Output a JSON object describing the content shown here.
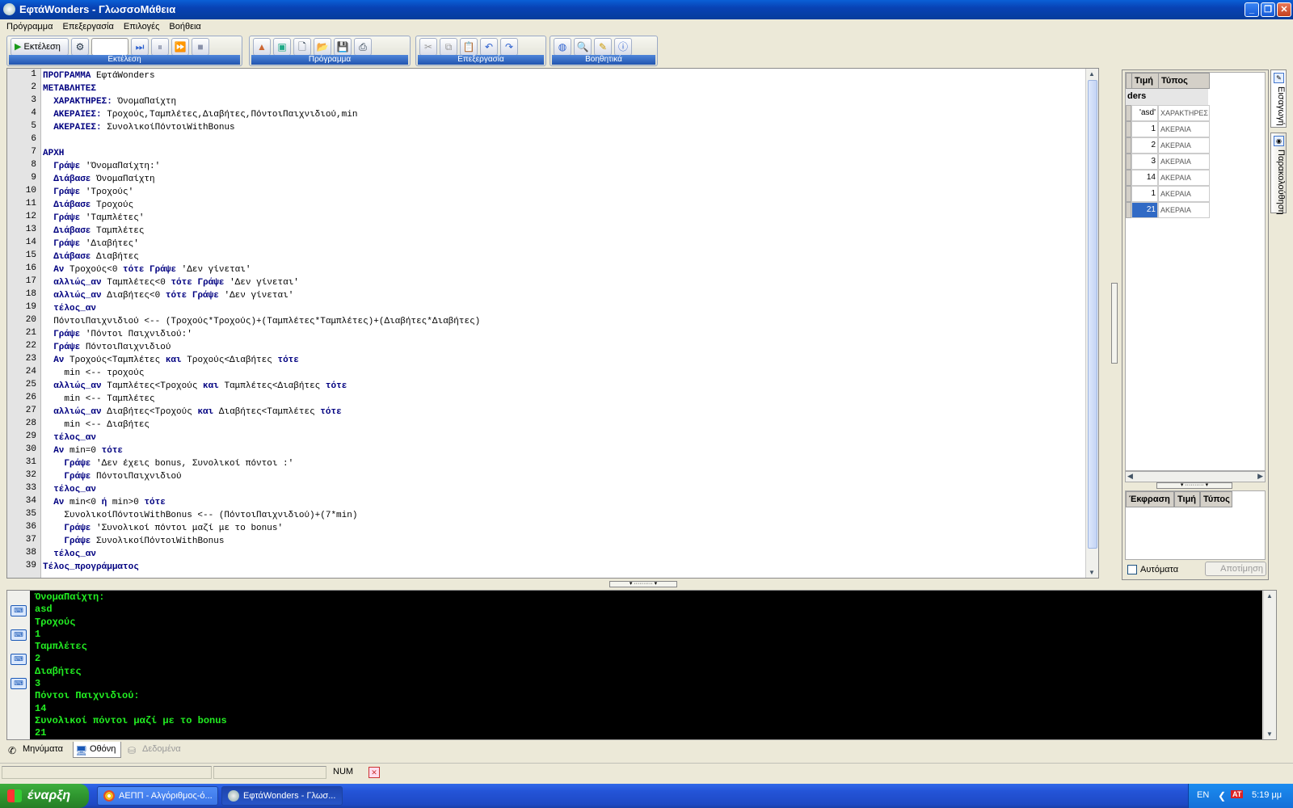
{
  "window": {
    "title": "ΕφτάWonders - ΓλωσσοΜάθεια"
  },
  "menu": [
    "Πρόγραμμα",
    "Επεξεργασία",
    "Επιλογές",
    "Βοήθεια"
  ],
  "toolbars": {
    "run_label": "Εκτέλεση",
    "groups": [
      "Εκτέλεση",
      "Πρόγραμμα",
      "Επεξεργασία",
      "Βοηθητικά"
    ]
  },
  "editor": {
    "lines": [
      {
        "n": "1",
        "parts": [
          {
            "t": "ΠΡΟΓΡΑΜΜΑ",
            "k": true
          },
          {
            "t": " ΕφτάWonders"
          }
        ]
      },
      {
        "n": "2",
        "parts": [
          {
            "t": "ΜΕΤΑΒΛΗΤΕΣ",
            "k": true
          }
        ]
      },
      {
        "n": "3",
        "parts": [
          {
            "t": "  "
          },
          {
            "t": "ΧΑΡΑΚΤΗΡΕΣ:",
            "k": true
          },
          {
            "t": " ΌνομαΠαίχτη"
          }
        ]
      },
      {
        "n": "4",
        "parts": [
          {
            "t": "  "
          },
          {
            "t": "ΑΚΕΡΑΙΕΣ:",
            "k": true
          },
          {
            "t": " Τροχούς,Ταμπλέτες,Διαβήτες,ΠόντοιΠαιχνιδιού,min"
          }
        ]
      },
      {
        "n": "5",
        "parts": [
          {
            "t": "  "
          },
          {
            "t": "ΑΚΕΡΑΙΕΣ:",
            "k": true
          },
          {
            "t": " ΣυνολικοίΠόντοιWithBonus"
          }
        ]
      },
      {
        "n": "6",
        "parts": [
          {
            "t": ""
          }
        ]
      },
      {
        "n": "7",
        "parts": [
          {
            "t": "ΑΡΧΗ",
            "k": true
          }
        ]
      },
      {
        "n": "8",
        "parts": [
          {
            "t": "  "
          },
          {
            "t": "Γράψε",
            "k": true
          },
          {
            "t": " 'ΌνομαΠαίχτη:'"
          }
        ]
      },
      {
        "n": "9",
        "parts": [
          {
            "t": "  "
          },
          {
            "t": "Διάβασε",
            "k": true
          },
          {
            "t": " ΌνομαΠαίχτη"
          }
        ]
      },
      {
        "n": "10",
        "parts": [
          {
            "t": "  "
          },
          {
            "t": "Γράψε",
            "k": true
          },
          {
            "t": " 'Τροχούς'"
          }
        ]
      },
      {
        "n": "11",
        "parts": [
          {
            "t": "  "
          },
          {
            "t": "Διάβασε",
            "k": true
          },
          {
            "t": " Τροχούς"
          }
        ]
      },
      {
        "n": "12",
        "parts": [
          {
            "t": "  "
          },
          {
            "t": "Γράψε",
            "k": true
          },
          {
            "t": " 'Ταμπλέτες'"
          }
        ]
      },
      {
        "n": "13",
        "parts": [
          {
            "t": "  "
          },
          {
            "t": "Διάβασε",
            "k": true
          },
          {
            "t": " Ταμπλέτες"
          }
        ]
      },
      {
        "n": "14",
        "parts": [
          {
            "t": "  "
          },
          {
            "t": "Γράψε",
            "k": true
          },
          {
            "t": " 'Διαβήτες'"
          }
        ]
      },
      {
        "n": "15",
        "parts": [
          {
            "t": "  "
          },
          {
            "t": "Διάβασε",
            "k": true
          },
          {
            "t": " Διαβήτες"
          }
        ]
      },
      {
        "n": "16",
        "parts": [
          {
            "t": "  "
          },
          {
            "t": "Αν",
            "k": true
          },
          {
            "t": " Τροχούς<0 "
          },
          {
            "t": "τότε",
            "k": true
          },
          {
            "t": " "
          },
          {
            "t": "Γράψε",
            "k": true
          },
          {
            "t": " 'Δεν γίνεται'"
          }
        ]
      },
      {
        "n": "17",
        "parts": [
          {
            "t": "  "
          },
          {
            "t": "αλλιώς_αν",
            "k": true
          },
          {
            "t": " Ταμπλέτες<0 "
          },
          {
            "t": "τότε",
            "k": true
          },
          {
            "t": " "
          },
          {
            "t": "Γράψε",
            "k": true
          },
          {
            "t": " 'Δεν γίνεται'"
          }
        ]
      },
      {
        "n": "18",
        "parts": [
          {
            "t": "  "
          },
          {
            "t": "αλλιώς_αν",
            "k": true
          },
          {
            "t": " Διαβήτες<0 "
          },
          {
            "t": "τότε",
            "k": true
          },
          {
            "t": " "
          },
          {
            "t": "Γράψε",
            "k": true
          },
          {
            "t": " 'Δεν γίνεται'"
          }
        ]
      },
      {
        "n": "19",
        "parts": [
          {
            "t": "  "
          },
          {
            "t": "τέλος_αν",
            "k": true
          }
        ]
      },
      {
        "n": "20",
        "parts": [
          {
            "t": "  ΠόντοιΠαιχνιδιού <-- (Τροχούς*Τροχούς)+(Ταμπλέτες*Ταμπλέτες)+(Διαβήτες*Διαβήτες)"
          }
        ]
      },
      {
        "n": "21",
        "parts": [
          {
            "t": "  "
          },
          {
            "t": "Γράψε",
            "k": true
          },
          {
            "t": " 'Πόντοι Παιχνιδιού:'"
          }
        ]
      },
      {
        "n": "22",
        "parts": [
          {
            "t": "  "
          },
          {
            "t": "Γράψε",
            "k": true
          },
          {
            "t": " ΠόντοιΠαιχνιδιού"
          }
        ]
      },
      {
        "n": "23",
        "parts": [
          {
            "t": "  "
          },
          {
            "t": "Αν",
            "k": true
          },
          {
            "t": " Τροχούς<Ταμπλέτες "
          },
          {
            "t": "και",
            "k": true
          },
          {
            "t": " Τροχούς<Διαβήτες "
          },
          {
            "t": "τότε",
            "k": true
          }
        ]
      },
      {
        "n": "24",
        "parts": [
          {
            "t": "    min <-- τροχούς"
          }
        ]
      },
      {
        "n": "25",
        "parts": [
          {
            "t": "  "
          },
          {
            "t": "αλλιώς_αν",
            "k": true
          },
          {
            "t": " Ταμπλέτες<Τροχούς "
          },
          {
            "t": "και",
            "k": true
          },
          {
            "t": " Ταμπλέτες<Διαβήτες "
          },
          {
            "t": "τότε",
            "k": true
          }
        ]
      },
      {
        "n": "26",
        "parts": [
          {
            "t": "    min <-- Ταμπλέτες"
          }
        ]
      },
      {
        "n": "27",
        "parts": [
          {
            "t": "  "
          },
          {
            "t": "αλλιώς_αν",
            "k": true
          },
          {
            "t": " Διαβήτες<Τροχούς "
          },
          {
            "t": "και",
            "k": true
          },
          {
            "t": " Διαβήτες<Ταμπλέτες "
          },
          {
            "t": "τότε",
            "k": true
          }
        ]
      },
      {
        "n": "28",
        "parts": [
          {
            "t": "    min <-- Διαβήτες"
          }
        ]
      },
      {
        "n": "29",
        "parts": [
          {
            "t": "  "
          },
          {
            "t": "τέλος_αν",
            "k": true
          }
        ]
      },
      {
        "n": "30",
        "parts": [
          {
            "t": "  "
          },
          {
            "t": "Αν",
            "k": true
          },
          {
            "t": " min=0 "
          },
          {
            "t": "τότε",
            "k": true
          }
        ]
      },
      {
        "n": "31",
        "parts": [
          {
            "t": "    "
          },
          {
            "t": "Γράψε",
            "k": true
          },
          {
            "t": " 'Δεν έχεις bonus, Συνολικοί πόντοι :'"
          }
        ]
      },
      {
        "n": "32",
        "parts": [
          {
            "t": "    "
          },
          {
            "t": "Γράψε",
            "k": true
          },
          {
            "t": " ΠόντοιΠαιχνιδιού"
          }
        ]
      },
      {
        "n": "33",
        "parts": [
          {
            "t": "  "
          },
          {
            "t": "τέλος_αν",
            "k": true
          }
        ]
      },
      {
        "n": "34",
        "parts": [
          {
            "t": "  "
          },
          {
            "t": "Αν",
            "k": true
          },
          {
            "t": " min<0 "
          },
          {
            "t": "ή",
            "k": true
          },
          {
            "t": " min>0 "
          },
          {
            "t": "τότε",
            "k": true
          }
        ]
      },
      {
        "n": "35",
        "parts": [
          {
            "t": "    ΣυνολικοίΠόντοιWithBonus <-- (ΠόντοιΠαιχνιδιού)+(7*min)"
          }
        ]
      },
      {
        "n": "36",
        "parts": [
          {
            "t": "    "
          },
          {
            "t": "Γράψε",
            "k": true
          },
          {
            "t": " 'Συνολικοί πόντοι μαζί με το bonus'"
          }
        ]
      },
      {
        "n": "37",
        "parts": [
          {
            "t": "    "
          },
          {
            "t": "Γράψε",
            "k": true
          },
          {
            "t": " ΣυνολικοίΠόντοιWithBonus"
          }
        ]
      },
      {
        "n": "38",
        "parts": [
          {
            "t": "  "
          },
          {
            "t": "τέλος_αν",
            "k": true
          }
        ]
      },
      {
        "n": "39",
        "parts": [
          {
            "t": "Τέλος_προγράμματος",
            "k": true
          }
        ]
      }
    ]
  },
  "variables": {
    "headers": {
      "value": "Τιμή",
      "type": "Τύπος",
      "name_partial": "ders"
    },
    "rows": [
      {
        "value": "'asd'",
        "type": "ΧΑΡΑΚΤΗΡΕΣ"
      },
      {
        "value": "1",
        "type": "ΑΚΕΡΑΙΑ"
      },
      {
        "value": "2",
        "type": "ΑΚΕΡΑΙΑ"
      },
      {
        "value": "3",
        "type": "ΑΚΕΡΑΙΑ"
      },
      {
        "value": "14",
        "type": "ΑΚΕΡΑΙΑ"
      },
      {
        "value": "1",
        "type": "ΑΚΕΡΑΙΑ"
      },
      {
        "value": "21",
        "type": "ΑΚΕΡΑΙΑ",
        "selected": true
      }
    ]
  },
  "expressions": {
    "headers": [
      "Έκφραση",
      "Τιμή",
      "Τύπος"
    ],
    "auto_label": "Αυτόματα",
    "store_label": "Αποτίμηση"
  },
  "side_tabs": [
    "Εισαγωγή",
    "Παρακολούθηση"
  ],
  "console": {
    "lines": [
      "ΌνομαΠαίχτη:",
      "asd",
      "Τροχούς",
      "1",
      "Ταμπλέτες",
      "2",
      "Διαβήτες",
      "3",
      "Πόντοι Παιχνιδιού:",
      "14",
      "Συνολικοί πόντοι μαζί με το bonus",
      "21"
    ]
  },
  "bottom_tabs": {
    "messages": "Μηνύματα",
    "screen": "Οθόνη",
    "data": "Δεδομένα"
  },
  "status": {
    "num": "NUM"
  },
  "taskbar": {
    "start": "έναρξη",
    "tasks": [
      "ΑΕΠΠ - Αλγόριθμος-ό...",
      "ΕφτάWonders - Γλωσ..."
    ],
    "lang": "EN",
    "clock": "5:19 μμ"
  }
}
